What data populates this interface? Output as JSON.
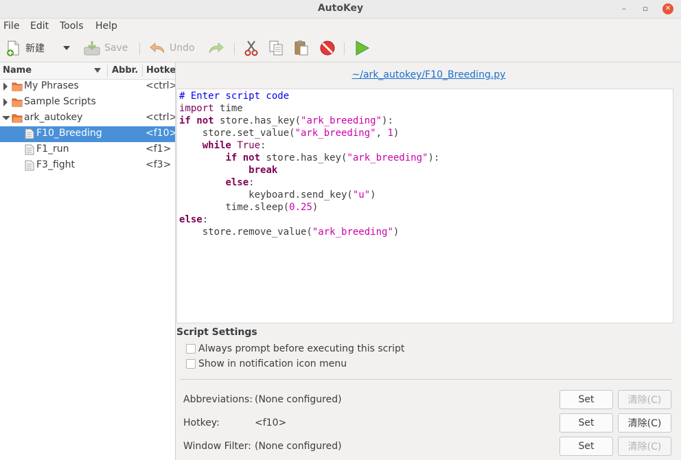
{
  "window": {
    "title": "AutoKey"
  },
  "menu": [
    "File",
    "Edit",
    "Tools",
    "Help"
  ],
  "toolbar": {
    "new_label": "新建",
    "save_label": "Save",
    "undo_label": "Undo"
  },
  "tree": {
    "columns": [
      "Name",
      "Abbr.",
      "Hotke"
    ],
    "rows": [
      {
        "name": "My Phrases",
        "hotkey": "<ctrl>+"
      },
      {
        "name": "Sample Scripts",
        "hotkey": ""
      },
      {
        "name": "ark_autokey",
        "hotkey": "<ctrl>+"
      },
      {
        "name": "F10_Breeding",
        "hotkey": "<f10>"
      },
      {
        "name": "F1_run",
        "hotkey": "<f1>"
      },
      {
        "name": "F3_fight",
        "hotkey": "<f3>"
      }
    ]
  },
  "editor": {
    "file_path": "~/ark_autokey/F10_Breeding.py",
    "code": [
      "# Enter script code",
      "import time",
      "if not store.has_key(\"ark_breeding\"):",
      "    store.set_value(\"ark_breeding\", 1)",
      "    while True:",
      "        if not store.has_key(\"ark_breeding\"):",
      "            break",
      "        else:",
      "            keyboard.send_key(\"u\")",
      "        time.sleep(0.25)",
      "else:",
      "    store.remove_value(\"ark_breeding\")"
    ]
  },
  "settings": {
    "title": "Script Settings",
    "always_prompt": "Always prompt before executing this script",
    "show_in_menu": "Show in notification icon menu",
    "abbreviations_label": "Abbreviations:",
    "abbreviations_value": "(None configured)",
    "hotkey_label": "Hotkey:",
    "hotkey_value": "<f10>",
    "window_filter_label": "Window Filter:",
    "window_filter_value": "(None configured)",
    "set_label": "Set",
    "clear_label": "清除(C)"
  },
  "colors": {
    "selection": "#4a90d9",
    "link": "#1a6ec9",
    "close_button": "#e9553a"
  }
}
